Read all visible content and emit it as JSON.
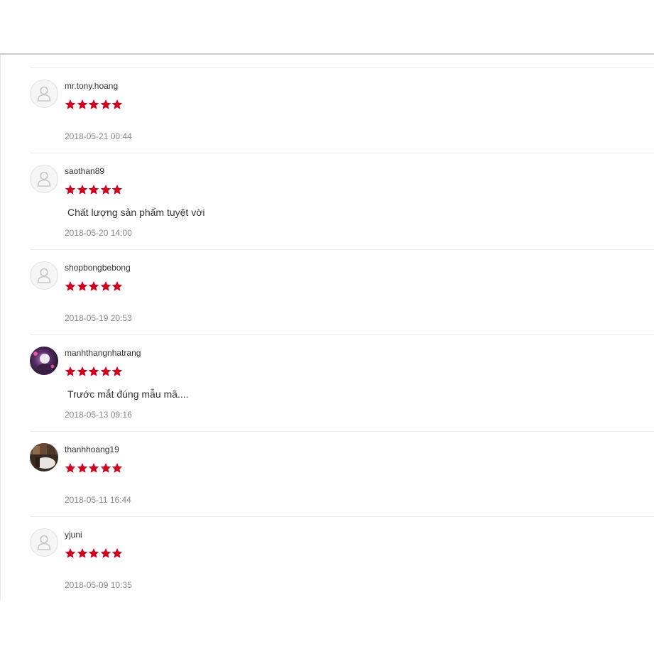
{
  "reviews": [
    {
      "author": "mr.tony.hoang",
      "rating": 5,
      "comment": "",
      "date": "2018-05-21 00:44",
      "avatar": "default-user-icon"
    },
    {
      "author": "saothan89",
      "rating": 5,
      "comment": "Chất lượng sản phẩm tuyệt vời",
      "date": "2018-05-20 14:00",
      "avatar": "default-user-icon"
    },
    {
      "author": "shopbongbebong",
      "rating": 5,
      "comment": "",
      "date": "2018-05-19 20:53",
      "avatar": "default-user-icon"
    },
    {
      "author": "manhthangnhatrang",
      "rating": 5,
      "comment": "Trước mắt đúng mẫu mã....",
      "date": "2018-05-13 09:16",
      "avatar": "photo-avatar"
    },
    {
      "author": "thanhhoang19",
      "rating": 5,
      "comment": "",
      "date": "2018-05-11 16:44",
      "avatar": "photo-avatar"
    },
    {
      "author": "yjuni",
      "rating": 5,
      "comment": "",
      "date": "2018-05-09 10:35",
      "avatar": "default-user-icon"
    }
  ],
  "colors": {
    "star": "#d0011b",
    "date": "#888888",
    "divider": "#e8e8e8"
  }
}
